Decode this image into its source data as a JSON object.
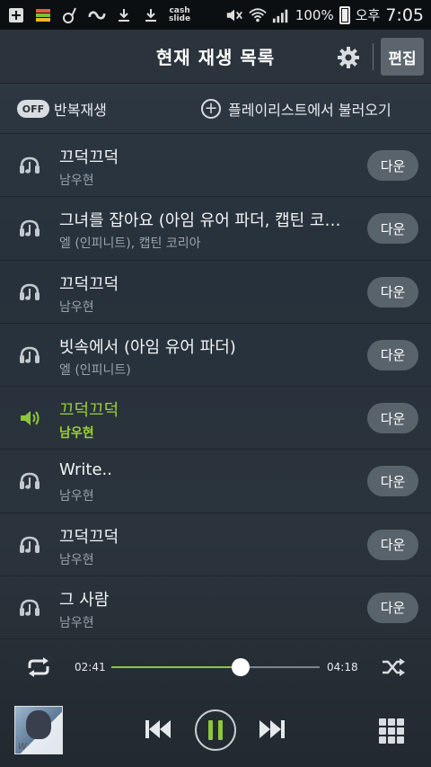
{
  "status": {
    "battery": "100%",
    "ampm": "오후",
    "time": "7:05",
    "cash_line1": "cash",
    "cash_line2": "slide"
  },
  "header": {
    "title": "현재 재생 목록",
    "edit_label": "편집"
  },
  "controls": {
    "repeat_state": "OFF",
    "repeat_label": "반복재생",
    "load_playlist_label": "플레이리스트에서 불러오기"
  },
  "playlist": [
    {
      "title": "끄덕끄덕",
      "artist": "남우현",
      "download_label": "다운",
      "playing": false
    },
    {
      "title": "그녀를 잡아요 (아임 유어 파더, 캡틴 코리아)",
      "artist": "엘 (인피니트), 캡틴 코리아",
      "download_label": "다운",
      "playing": false
    },
    {
      "title": "끄덕끄덕",
      "artist": "남우현",
      "download_label": "다운",
      "playing": false
    },
    {
      "title": "빗속에서 (아임 유어 파더)",
      "artist": "엘 (인피니트)",
      "download_label": "다운",
      "playing": false
    },
    {
      "title": "끄덕끄덕",
      "artist": "남우현",
      "download_label": "다운",
      "playing": true
    },
    {
      "title": "Write..",
      "artist": "남우현",
      "download_label": "다운",
      "playing": false
    },
    {
      "title": "끄덕끄덕",
      "artist": "남우현",
      "download_label": "다운",
      "playing": false
    },
    {
      "title": "그 사람",
      "artist": "남우현",
      "download_label": "다운",
      "playing": false
    }
  ],
  "progress": {
    "current": "02:41",
    "total": "04:18",
    "fraction": 0.62
  },
  "colors": {
    "accent": "#8dc63f",
    "playing_text": "#9ed231"
  },
  "icons": {
    "settings": "gear-icon",
    "repeat": "repeat-icon",
    "shuffle": "shuffle-icon",
    "previous": "previous-icon",
    "pause": "pause-icon",
    "next": "next-icon",
    "menu": "grid-icon"
  }
}
